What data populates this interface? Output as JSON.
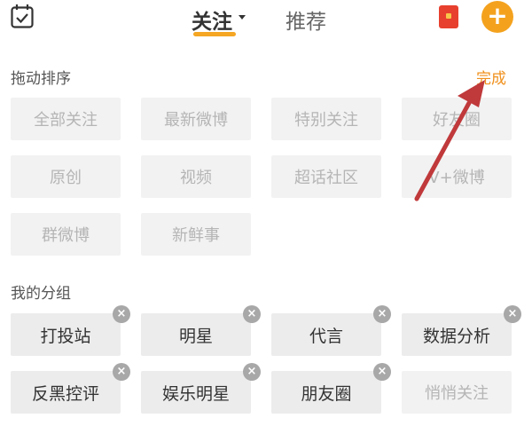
{
  "header": {
    "tabs": [
      {
        "label": "关注",
        "active": true
      },
      {
        "label": "推荐",
        "active": false
      }
    ],
    "icons": [
      "calendar-check-icon",
      "red-packet-icon",
      "add-icon"
    ],
    "add_glyph": "+"
  },
  "drag_sort": {
    "label": "拖动排序",
    "done_label": "完成",
    "items": [
      "全部关注",
      "最新微博",
      "特别关注",
      "好友圈",
      "原创",
      "视频",
      "超话社区",
      "V+微博",
      "群微博",
      "新鲜事"
    ]
  },
  "my_groups": {
    "label": "我的分组",
    "remove_glyph": "×",
    "items": [
      "打投站",
      "明星",
      "代言",
      "数据分析",
      "反黑控评",
      "娱乐明星",
      "朋友圈"
    ],
    "placeholder_item": "悄悄关注"
  },
  "colors": {
    "accent": "#f4a21e",
    "annotation_arrow": "#c0393b"
  }
}
